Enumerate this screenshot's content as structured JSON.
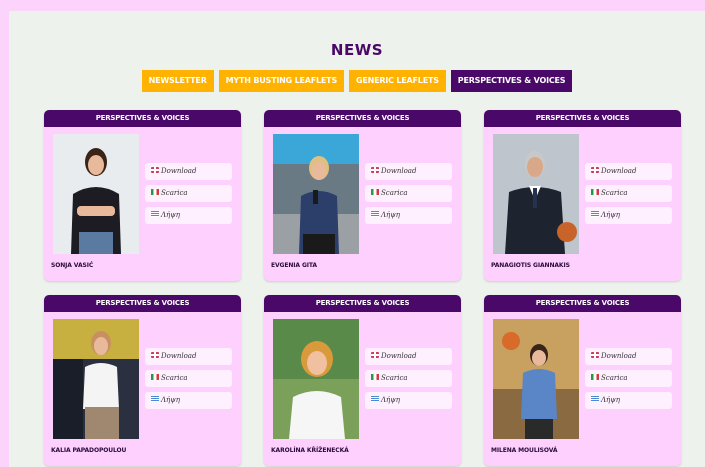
{
  "page": {
    "title": "NEWS"
  },
  "tabs": [
    {
      "label": "NEWSLETTER",
      "active": false
    },
    {
      "label": "MYTH BUSTING LEAFLETS",
      "active": false
    },
    {
      "label": "GENERIC LEAFLETS",
      "active": false
    },
    {
      "label": "PERSPECTIVES & VOICES",
      "active": true
    }
  ],
  "cards": [
    {
      "category": "PERSPECTIVES & VOICES",
      "name": "SONJA VASIĆ",
      "links": [
        {
          "label": "Download",
          "flag": "en-flag-icon"
        },
        {
          "label": "Scarica",
          "flag": "it-flag-icon"
        },
        {
          "label": "Λήψη",
          "flag": "gr-flag-icon"
        }
      ]
    },
    {
      "category": "PERSPECTIVES & VOICES",
      "name": "EVGENIA GITA",
      "links": [
        {
          "label": "Download",
          "flag": "en-flag-icon"
        },
        {
          "label": "Scarica",
          "flag": "it-flag-icon"
        },
        {
          "label": "Λήψη",
          "flag": "gr-flag-icon"
        }
      ]
    },
    {
      "category": "PERSPECTIVES & VOICES",
      "name": "PANAGIOTIS GIANNAKIS",
      "links": [
        {
          "label": "Download",
          "flag": "en-flag-icon"
        },
        {
          "label": "Scarica",
          "flag": "it-flag-icon"
        },
        {
          "label": "Λήψη",
          "flag": "gr-flag-icon"
        }
      ]
    },
    {
      "category": "PERSPECTIVES & VOICES",
      "name": "KALIA PAPADOPOULOU",
      "links": [
        {
          "label": "Download",
          "flag": "en-flag-icon"
        },
        {
          "label": "Scarica",
          "flag": "it-flag-icon"
        },
        {
          "label": "Λήψη",
          "flag": "gr-flag-icon"
        }
      ]
    },
    {
      "category": "PERSPECTIVES & VOICES",
      "name": "KAROLÍNA KŘÍŽENECKÁ",
      "links": [
        {
          "label": "Download",
          "flag": "en-flag-icon"
        },
        {
          "label": "Scarica",
          "flag": "it-flag-icon"
        },
        {
          "label": "Λήψη",
          "flag": "gr-flag-icon"
        }
      ]
    },
    {
      "category": "PERSPECTIVES & VOICES",
      "name": "MILENA MOULISOVÁ",
      "links": [
        {
          "label": "Download",
          "flag": "en-flag-icon"
        },
        {
          "label": "Scarica",
          "flag": "it-flag-icon"
        },
        {
          "label": "Λήψη",
          "flag": "gr-flag-icon"
        }
      ]
    }
  ],
  "colors": {
    "accent": "#4a0868",
    "tab": "#ffb300",
    "card": "#fdd0fd",
    "background": "#eef2ec"
  }
}
